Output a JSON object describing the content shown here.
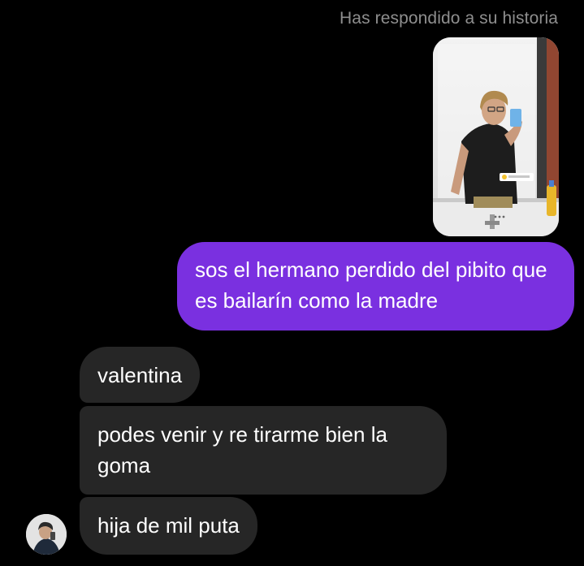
{
  "story_reply": {
    "caption": "Has respondido a su historia",
    "thumbnail_alt": "story-photo"
  },
  "messages": {
    "sent": [
      {
        "text": "sos el hermano perdido del pibito que es bailarín como la madre"
      }
    ],
    "received": [
      {
        "text": "valentina"
      },
      {
        "text": "podes venir y re tirarme bien la goma"
      },
      {
        "text": "hija de mil puta"
      }
    ]
  },
  "colors": {
    "background": "#000000",
    "sent_bubble": "#7a30e0",
    "received_bubble": "#262626",
    "caption_text": "#8e8e8e",
    "message_text": "#ffffff"
  }
}
